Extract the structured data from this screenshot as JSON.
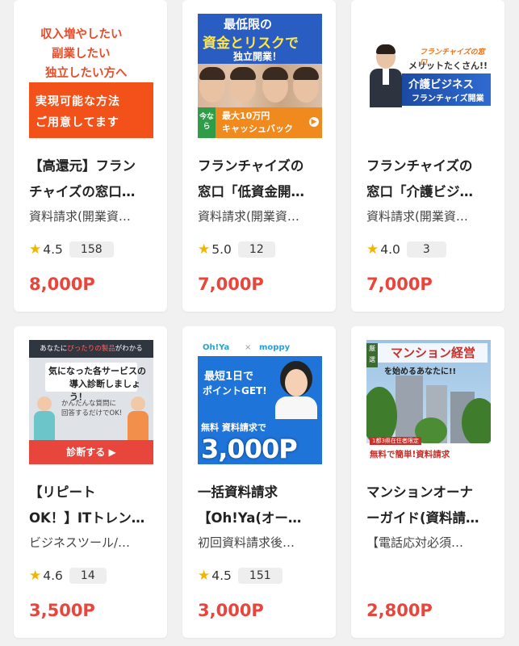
{
  "cards": [
    {
      "title_line1": "【高還元】フラン",
      "title_line2": "チャイズの窓口…",
      "description": "資料請求(開業資…",
      "rating": "4.5",
      "review_count": "158",
      "price": "8,000P",
      "banner": {
        "lines": [
          "収入増やしたい",
          "副業したい",
          "独立したい方へ"
        ],
        "bottom_lines": [
          "実現可能な方法",
          "ご用意してます"
        ]
      }
    },
    {
      "title_line1": "フランチャイズの",
      "title_line2": "窓口「低資金開…",
      "description": "資料請求(開業資…",
      "rating": "5.0",
      "review_count": "12",
      "price": "7,000P",
      "banner": {
        "line1": "最低限の",
        "line2": "資金とリスクで",
        "line3": "独立開業！",
        "side": "今なら",
        "bottom1": "最大10万円",
        "bottom2": "キャッシュバック"
      }
    },
    {
      "title_line1": "フランチャイズの",
      "title_line2": "窓口「介護ビジ…",
      "description": "資料請求(開業資…",
      "rating": "4.0",
      "review_count": "3",
      "price": "7,000P",
      "banner": {
        "line1": "フランチャイズの窓口",
        "line2": "メリットたくさん!!",
        "line3": "介護ビジネス",
        "line4": "フランチャイズ開業"
      }
    },
    {
      "title_line1": "【リピート",
      "title_line2": "OK！】ITトレン…",
      "description": "ビジネスツール/…",
      "rating": "4.6",
      "review_count": "14",
      "price": "3,500P",
      "banner": {
        "header_a": "あなたに",
        "header_b": "ぴったりの製品",
        "header_c": "がわかる",
        "box1": "気になった各サービスの",
        "box2": "導入診断しましょう！",
        "sub1": "かんたんな質問に",
        "sub2": "回答するだけでOK!",
        "button": "診断する ▶"
      }
    },
    {
      "title_line1": "一括資料請求",
      "title_line2": "【Oh!Ya(オー…",
      "description": "初回資料請求後…",
      "rating": "4.5",
      "review_count": "151",
      "price": "3,000P",
      "banner": {
        "logo_a": "Oh!Ya",
        "logo_x": "×",
        "logo_b": "moppy",
        "line1": "最短1日で",
        "line2": "ポイントGET!",
        "line3": "無料 資料請求で",
        "big": "3,000P"
      }
    },
    {
      "title_line1": "マンションオーナ",
      "title_line2": "ーガイド(資料請…",
      "description": "【電話応対必須…",
      "rating": "",
      "review_count": "",
      "price": "2,800P",
      "banner": {
        "tag": "厳選",
        "line1": "マンション経営",
        "line2": "を始めるあなたに!!",
        "foot1": "1都3県在住者限定",
        "foot2": "無料で簡単!資料請求"
      }
    }
  ]
}
